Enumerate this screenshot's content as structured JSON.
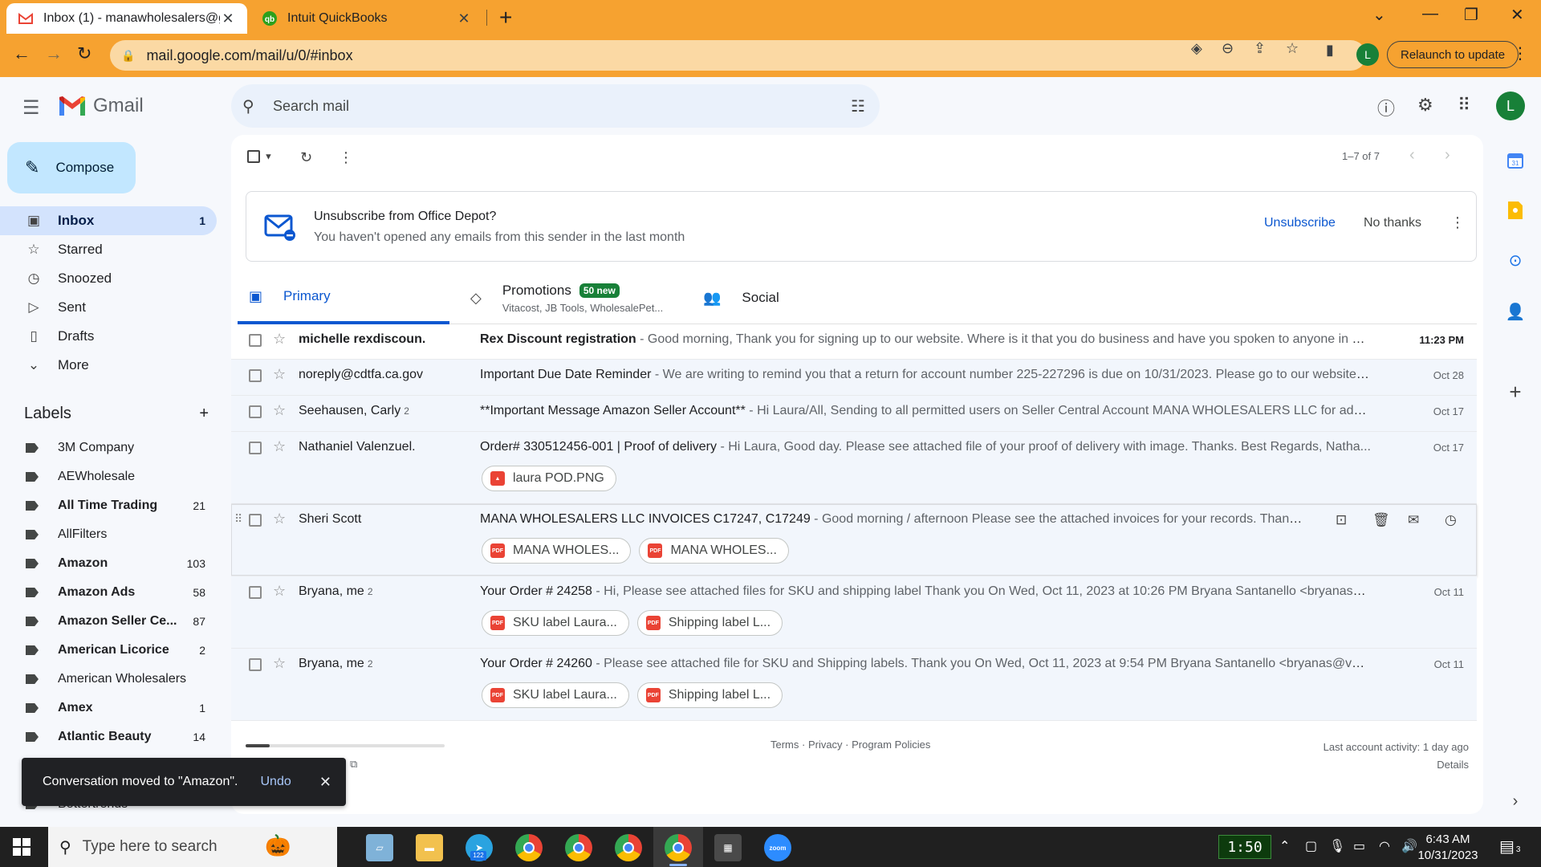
{
  "browser": {
    "tabs": [
      {
        "title": "Inbox (1) - manawholesalers@gi",
        "icon": "gmail-icon"
      },
      {
        "title": "Intuit QuickBooks",
        "icon": "quickbooks-icon"
      }
    ],
    "url": "mail.google.com/mail/u/0/#inbox",
    "profile_initial": "L",
    "relaunch_label": "Relaunch to update"
  },
  "gmail": {
    "wordmark": "Gmail",
    "search_placeholder": "Search mail",
    "avatar_initial": "L",
    "compose_label": "Compose"
  },
  "nav": {
    "items": [
      {
        "label": "Inbox",
        "count": "1",
        "icon": "inbox-icon",
        "active": true
      },
      {
        "label": "Starred",
        "count": "",
        "icon": "star-icon"
      },
      {
        "label": "Snoozed",
        "count": "",
        "icon": "clock-icon"
      },
      {
        "label": "Sent",
        "count": "",
        "icon": "send-icon"
      },
      {
        "label": "Drafts",
        "count": "",
        "icon": "draft-icon"
      },
      {
        "label": "More",
        "count": "",
        "icon": "chevron-down-icon"
      }
    ]
  },
  "labels": {
    "heading": "Labels",
    "items": [
      {
        "label": "3M Company",
        "count": "",
        "bold": false
      },
      {
        "label": "AEWholesale",
        "count": "",
        "bold": false
      },
      {
        "label": "All Time Trading",
        "count": "21",
        "bold": true
      },
      {
        "label": "AllFilters",
        "count": "",
        "bold": false
      },
      {
        "label": "Amazon",
        "count": "103",
        "bold": true
      },
      {
        "label": "Amazon Ads",
        "count": "58",
        "bold": true
      },
      {
        "label": "Amazon Seller Ce...",
        "count": "87",
        "bold": true
      },
      {
        "label": "American Licorice",
        "count": "2",
        "bold": true
      },
      {
        "label": "American Wholesalers",
        "count": "",
        "bold": false
      },
      {
        "label": "Amex",
        "count": "1",
        "bold": true
      },
      {
        "label": "Atlantic Beauty",
        "count": "14",
        "bold": true
      },
      {
        "label": "Bettertrends",
        "count": "",
        "bold": false
      }
    ]
  },
  "toolbar": {
    "pager": "1–7 of 7"
  },
  "unsubscribe": {
    "title": "Unsubscribe from Office Depot?",
    "subtitle": "You haven't opened any emails from this sender in the last month",
    "unsubscribe_label": "Unsubscribe",
    "no_thanks_label": "No thanks"
  },
  "tabs": {
    "primary": "Primary",
    "promotions": "Promotions",
    "promotions_badge": "50 new",
    "promotions_senders": "Vitacost, JB Tools, WholesalePet...",
    "social": "Social"
  },
  "emails": [
    {
      "sender": "michelle rexdiscoun.",
      "threads": "",
      "subject": "Rex Discount registration",
      "snippet": " - Good morning, Thank you for signing up to our website. Where is it that you do business and have you spoken to anyone in ou...",
      "date": "11:23 PM",
      "unread": true,
      "attachments": []
    },
    {
      "sender": "noreply@cdtfa.ca.gov",
      "threads": "",
      "subject": "Important Due Date Reminder",
      "snippet": " - We are writing to remind you that a return for account number 225-227296 is due on 10/31/2023. Please go to our website a...",
      "date": "Oct 28",
      "unread": false,
      "attachments": []
    },
    {
      "sender": "Seehausen, Carly",
      "threads": "2",
      "subject": "**Important Message Amazon Seller Account**",
      "snippet": " - Hi Laura/All, Sending to all permitted users on Seller Central Account MANA WHOLESALERS LLC for additi...",
      "date": "Oct 17",
      "unread": false,
      "attachments": []
    },
    {
      "sender": "Nathaniel Valenzuel.",
      "threads": "",
      "subject": "Order# 330512456-001 | Proof of delivery",
      "snippet": " - Hi Laura, Good day. Please see attached file of your proof of delivery with image. Thanks. Best Regards, Natha...",
      "date": "Oct 17",
      "unread": false,
      "attachments": [
        {
          "name": "laura POD.PNG",
          "type": "img"
        }
      ]
    },
    {
      "sender": "Sheri Scott",
      "threads": "",
      "subject": "MANA WHOLESALERS LLC INVOICES C17247, C17249",
      "snippet": " - Good morning / afternoon Please see the attached invoices for your records. Thank you, ...",
      "date": "",
      "unread": false,
      "hover": true,
      "attachments": [
        {
          "name": "MANA WHOLES...",
          "type": "pdf"
        },
        {
          "name": "MANA WHOLES...",
          "type": "pdf"
        }
      ]
    },
    {
      "sender": "Bryana, me",
      "threads": "2",
      "subject": "Your Order # 24258",
      "snippet": " - Hi, Please see attached files for SKU and shipping label Thank you On Wed, Oct 11, 2023 at 10:26 PM Bryana Santanello <bryanas@vgs...",
      "date": "Oct 11",
      "unread": false,
      "attachments": [
        {
          "name": "SKU label Laura...",
          "type": "pdf"
        },
        {
          "name": "Shipping label L...",
          "type": "pdf"
        }
      ]
    },
    {
      "sender": "Bryana, me",
      "threads": "2",
      "subject": "Your Order # 24260",
      "snippet": " - Please see attached file for SKU and Shipping labels. Thank you On Wed, Oct 11, 2023 at 9:54 PM Bryana Santanello <bryanas@vgsup...",
      "date": "Oct 11",
      "unread": false,
      "attachments": [
        {
          "name": "SKU label Laura...",
          "type": "pdf"
        },
        {
          "name": "Shipping label L...",
          "type": "pdf"
        }
      ]
    }
  ],
  "footer": {
    "links": "Terms · Privacy · Program Policies",
    "activity": "Last account activity: 1 day ago",
    "details": "Details",
    "storage_fraction": 0.12
  },
  "toast": {
    "message": "Conversation moved to \"Amazon\".",
    "undo": "Undo"
  },
  "taskbar": {
    "search_placeholder": "Type here to search",
    "clock_widget": "1:50",
    "time": "6:43 AM",
    "date": "10/31/2023",
    "telegram_badge": "122",
    "notif_count": "3"
  },
  "colors": {
    "browser_frame": "#f6a230",
    "inbox_active": "#d3e3fd",
    "compose": "#c2e7ff",
    "accent_blue": "#0b57d0"
  }
}
